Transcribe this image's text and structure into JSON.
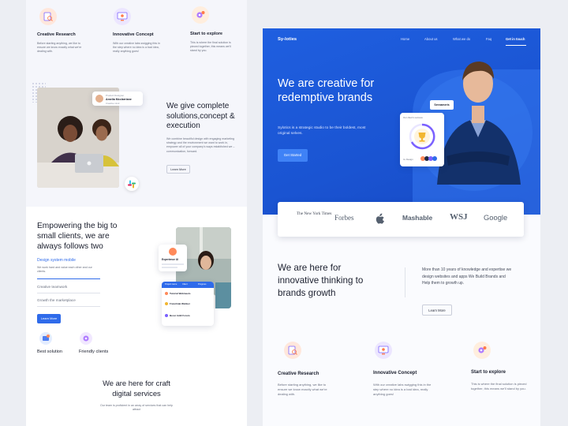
{
  "left": {
    "features": [
      {
        "title": "Creative Research",
        "desc": "Before starting anything, we like to ensure we know exactly what we're dealing with.",
        "icon": "research-icon"
      },
      {
        "title": "Innovative Concept",
        "desc": "With our creative labs swigging this in the step where no idea is a bad idea, really anything goes!",
        "icon": "concept-icon"
      },
      {
        "title": "Start to explore",
        "desc": "This is where the final solution is pieced together, this means we'll stand by you.",
        "icon": "explore-icon"
      }
    ],
    "solutions": {
      "profile_badge": {
        "role": "Product Designer",
        "name": "Amelia Mcclarriane",
        "sub": "Creative mind"
      },
      "title": "We give complete solutions,concept & execution",
      "desc": "We combine beautiful design with engaging marketing strategy and the environment we want to work in, empower all of your company's ways established we – communication, forward.",
      "button": "Learn More"
    },
    "empower": {
      "title": "Empowering the big to small clients, we are always follows two",
      "tabs": [
        {
          "label": "Design system mobile",
          "desc": "We work hard and value each other and our clients.",
          "active": true
        },
        {
          "label": "Creative teamwork",
          "active": false
        },
        {
          "label": "Growth the marketplace",
          "active": false
        }
      ],
      "button": "Learn More",
      "experience": {
        "label": "Experience UI"
      },
      "table_head": [
        "Project name",
        "Client",
        "Progress"
      ],
      "table_rows": [
        "Tutorial Webmeets",
        "Franchiak Webber",
        "Bessi Addi Forum"
      ],
      "bottom_items": [
        {
          "label": "Best solution",
          "icon": "solution-icon"
        },
        {
          "label": "Friendly clients",
          "icon": "clients-icon"
        }
      ]
    },
    "craft": {
      "title": "We are here for craft digital services",
      "desc": "Our team is proficient in an array of services that can help attract"
    }
  },
  "right": {
    "brand": "Sy-loties",
    "nav": [
      "Home",
      "About us",
      "What we do",
      "Faq"
    ],
    "nav_cta": "Get in touch",
    "hero": {
      "title": "We are creative for redemptive brands",
      "desc": "Sylotics is a strategic studio to be their boldest, most original selves.",
      "button": "Get Started",
      "chip": "Sennameris",
      "card_label": "Our client's success",
      "card_footer": "3+ Design"
    },
    "logos": [
      "The New York Times",
      "Forbes",
      "Apple",
      "Mashable",
      "WSJ",
      "Google"
    ],
    "innov": {
      "title": "We are here for innovative thinking to brands growth",
      "desc": "More than 10 years of knowledge and expertise we design websites and apps We Build Brands and Help them to growth up.",
      "button": "Learn More"
    },
    "features": [
      {
        "title": "Creative Research",
        "desc": "Before starting anything, we like to ensure we know exactly what we're dealing with.",
        "icon": "research-icon"
      },
      {
        "title": "Innovative Concept",
        "desc": "With our creative labs swigging this in the step where no idea is a bad idea, really anything goes!",
        "icon": "concept-icon"
      },
      {
        "title": "Start to explore",
        "desc": "This is where the final solution is pieced together, this means we'll stand by you.",
        "icon": "explore-icon"
      }
    ]
  },
  "colors": {
    "accent": "#2f6bea",
    "hero": "#1f5fe0",
    "peach": "#ffe3d6",
    "lavender": "#ece6ff",
    "gold": "#f2b630"
  }
}
